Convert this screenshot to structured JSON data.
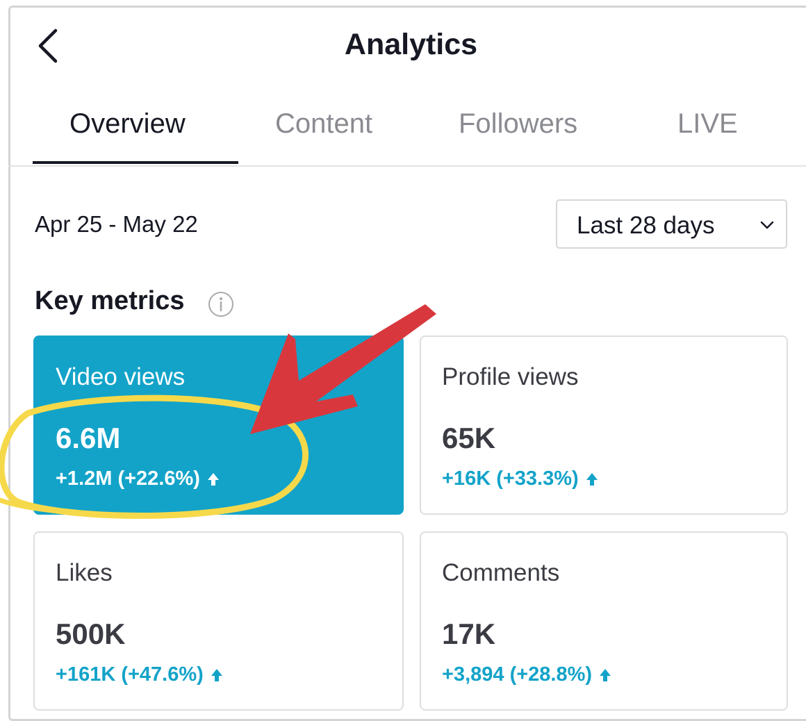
{
  "header": {
    "back_icon": "chevron-left-icon",
    "title": "Analytics"
  },
  "tabs": [
    {
      "label": "Overview",
      "active": true
    },
    {
      "label": "Content",
      "active": false
    },
    {
      "label": "Followers",
      "active": false
    },
    {
      "label": "LIVE",
      "active": false
    }
  ],
  "date_range": "Apr 25 - May 22",
  "period_select": {
    "label": "Last 28 days",
    "icon": "chevron-down-icon"
  },
  "key_metrics": {
    "title": "Key metrics",
    "info_icon": "info-icon",
    "cards": [
      {
        "label": "Video views",
        "value": "6.6M",
        "change": "+1.2M (+22.6%)",
        "selected": true
      },
      {
        "label": "Profile views",
        "value": "65K",
        "change": "+16K (+33.3%)",
        "selected": false
      },
      {
        "label": "Likes",
        "value": "500K",
        "change": "+161K (+47.6%)",
        "selected": false
      },
      {
        "label": "Comments",
        "value": "17K",
        "change": "+3,894 (+28.8%)",
        "selected": false
      }
    ]
  },
  "annotations": {
    "highlight_circle_color": "#f6d94a",
    "arrow_color": "#d8383d"
  },
  "colors": {
    "accent": "#13a3c9",
    "text": "#161823",
    "muted": "#8a8b91"
  }
}
